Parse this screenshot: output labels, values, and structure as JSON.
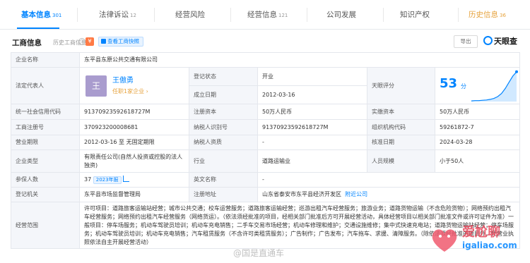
{
  "tabs": [
    {
      "label": "基本信息",
      "count": "301"
    },
    {
      "label": "法律诉讼",
      "count": "12"
    },
    {
      "label": "经营风险",
      "count": ""
    },
    {
      "label": "经营信息",
      "count": "121"
    },
    {
      "label": "公司发展",
      "count": ""
    },
    {
      "label": "知识产权",
      "count": ""
    },
    {
      "label": "历史信息",
      "count": "36"
    }
  ],
  "section": {
    "title": "工商信息",
    "subtitle": "历史工商信息",
    "subtitle_count": "9",
    "badge": "¥",
    "report_button": "查看工商快照",
    "export_label": "导出",
    "brand": "天眼查"
  },
  "info": {
    "company_name_label": "企业名称",
    "company_name": "东平县东原公共交通有限公司",
    "legal_rep_label": "法定代表人",
    "legal_rep_avatar": "王",
    "legal_rep_name": "王傲勇",
    "legal_rep_sub": "任职1家企业 ›",
    "status_label": "登记状态",
    "status": "开业",
    "founded_label": "成立日期",
    "founded": "2012-03-16",
    "score_label": "天眼评分",
    "score": "53",
    "score_unit": "分",
    "credit_code_label": "统一社会信用代码",
    "credit_code": "91370923592618727M",
    "reg_capital_label": "注册资本",
    "reg_capital": "50万人民币",
    "paid_capital_label": "实缴资本",
    "paid_capital": "50万人民币",
    "reg_no_label": "工商注册号",
    "reg_no": "370923200008681",
    "taxpayer_id_label": "纳税人识别号",
    "taxpayer_id": "91370923592618727M",
    "org_code_label": "组织机构代码",
    "org_code": "59261872-7",
    "term_label": "营业期限",
    "term": "2012-03-16 至 无固定期限",
    "taxpayer_qual_label": "纳税人资质",
    "taxpayer_qual": "-",
    "approval_date_label": "核准日期",
    "approval_date": "2024-03-28",
    "company_type_label": "企业类型",
    "company_type": "有限责任公司(自然人投资或控股的法人独资)",
    "industry_label": "行业",
    "industry": "道路运输业",
    "staff_label": "人员规模",
    "staff": "小于50人",
    "insured_label": "参保人数",
    "insured": "37",
    "insured_tag": "2023年报",
    "english_label": "英文名称",
    "english": "-",
    "authority_label": "登记机关",
    "authority": "东平县市场监督管理局",
    "address_label": "注册地址",
    "address": "山东省泰安市东平县经济开发区",
    "address_link": "附近公司",
    "scope_label": "经营范围",
    "scope": "许可项目：道路旅客运输站经营；城市公共交通；校车运营服务；道路旅客运输经营；巡游出租汽车经营服务；旅游业务；道路货物运输（不含危险货物）；网络预约出租汽车经营服务；网络预约出租汽车经营服务（网络货运）。（依法须经批准的项目，经相关部门批准后方可开展经营活动，具体经营项目以相关部门批准文件或许可证件为准）一般项目：停车场服务；机动车驾驶员培训；机动车充电销售；二手车交易市场经营；机动车修理和维护；交通设施维修；集中式快速充电站；道路货物运输站经营；停车场服务；机动车驾驶员培训；机动车充电销售；汽车租赁服务（不含许可类租赁服务）；广告制作；广告发布；汽车拖车、求援、清障服务。（除依法须经批准的项目外，凭营业执照依法自主开展经营活动）"
  },
  "score_trend": [
    0.02,
    0.03,
    0.03,
    0.04,
    0.05,
    0.07,
    0.1,
    0.16,
    0.26,
    0.42,
    0.62,
    0.82,
    0.96
  ],
  "watermark": {
    "weibo": "@国是直通车",
    "logo_text": "爱尬聊",
    "logo_url": "igaliao.com"
  },
  "colors": {
    "accent": "#0084ff",
    "history": "#e6a23c",
    "label_bg": "#f4f6fa",
    "avatar": "#a99cce"
  }
}
